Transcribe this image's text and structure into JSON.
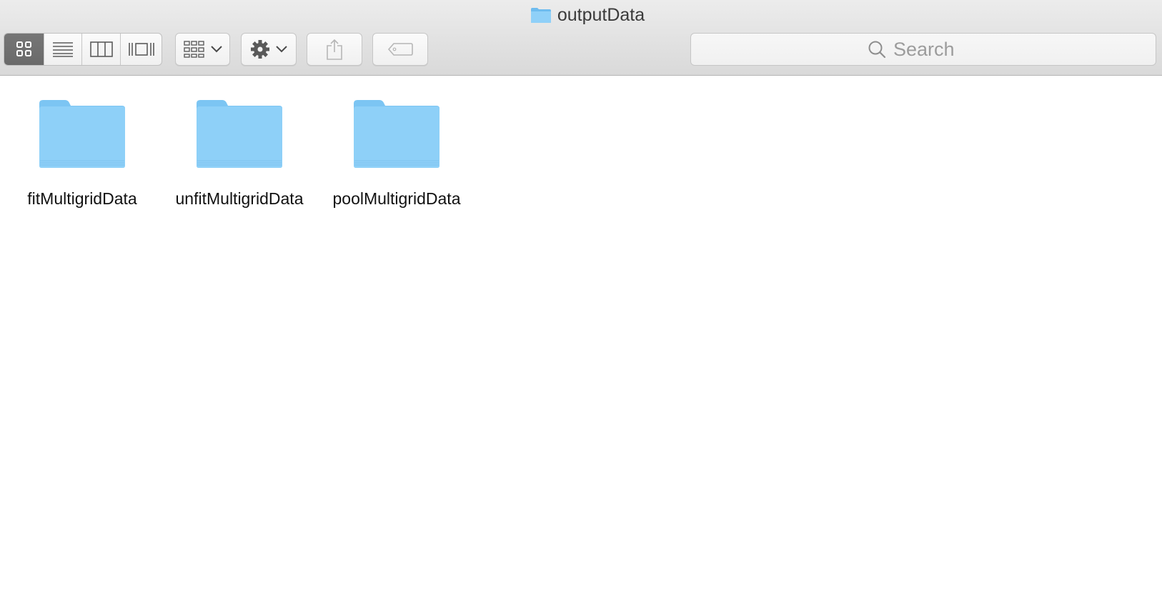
{
  "window": {
    "title": "outputData",
    "title_icon": "folder-icon"
  },
  "toolbar": {
    "view_modes": [
      {
        "name": "icon-view",
        "icon": "grid-icon",
        "active": true
      },
      {
        "name": "list-view",
        "icon": "list-icon",
        "active": false
      },
      {
        "name": "column-view",
        "icon": "columns-icon",
        "active": false
      },
      {
        "name": "cover-flow-view",
        "icon": "cover-flow-icon",
        "active": false
      }
    ],
    "arrange_icon": "arrange-grid-icon",
    "action_icon": "gear-icon",
    "share_icon": "share-icon",
    "tag_icon": "tag-icon",
    "search": {
      "placeholder": "Search",
      "value": "",
      "icon": "search-icon"
    }
  },
  "files": [
    {
      "name": "fitMultigridData",
      "kind": "folder"
    },
    {
      "name": "unfitMultigridData",
      "kind": "folder"
    },
    {
      "name": "poolMultigridData",
      "kind": "folder"
    }
  ],
  "colors": {
    "folder_light": "#8fcff7",
    "folder_dark": "#6ebcef",
    "toolbar_active": "#6e6e6e"
  }
}
